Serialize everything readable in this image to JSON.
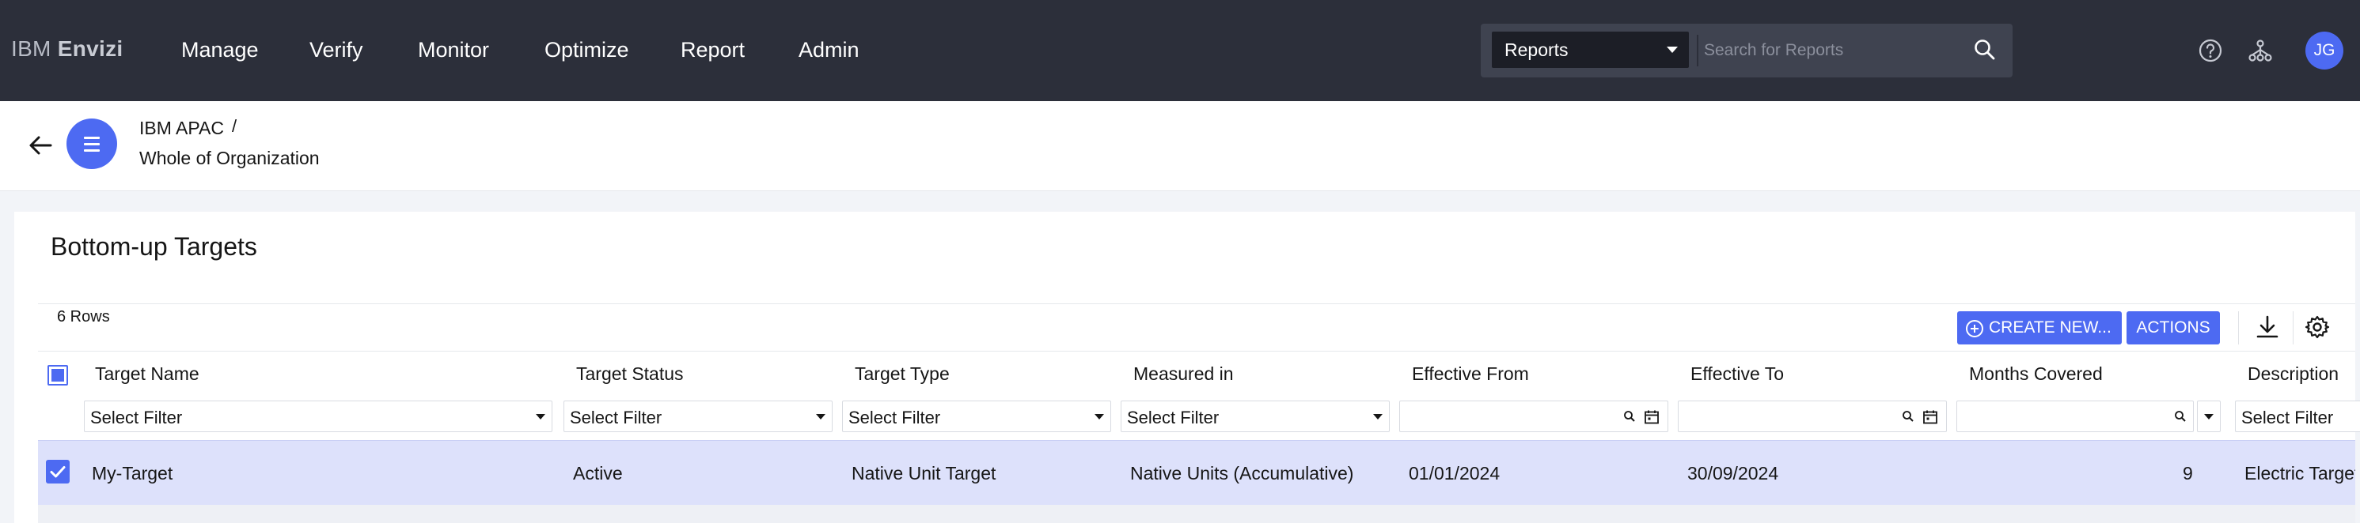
{
  "header": {
    "brand_prefix": "IBM",
    "brand_name": "Envizi",
    "nav": [
      "Manage",
      "Verify",
      "Monitor",
      "Optimize",
      "Report",
      "Admin"
    ],
    "search": {
      "scope": "Reports",
      "placeholder": "Search for Reports"
    },
    "icons": [
      "help-icon",
      "hierarchy-icon"
    ],
    "avatar_initials": "JG"
  },
  "breadcrumb": {
    "parent": "IBM APAC",
    "separator": "/",
    "current": "Whole of Organization"
  },
  "main": {
    "title": "Bottom-up Targets",
    "row_count": "6 Rows",
    "create_button": "CREATE NEW...",
    "actions_button": "ACTIONS",
    "columns": [
      {
        "label": "Target Name",
        "filter": "Select Filter",
        "filter_type": "select"
      },
      {
        "label": "Target Status",
        "filter": "Select Filter",
        "filter_type": "select"
      },
      {
        "label": "Target Type",
        "filter": "Select Filter",
        "filter_type": "select"
      },
      {
        "label": "Measured in",
        "filter": "Select Filter",
        "filter_type": "select"
      },
      {
        "label": "Effective From",
        "filter": "",
        "filter_type": "date"
      },
      {
        "label": "Effective To",
        "filter": "",
        "filter_type": "date"
      },
      {
        "label": "Months Covered",
        "filter": "",
        "filter_type": "number"
      },
      {
        "label": "Description",
        "filter": "Select Filter",
        "filter_type": "select"
      }
    ],
    "rows": [
      {
        "selected": true,
        "cells": [
          "My-Target",
          "Active",
          "Native Unit Target",
          "Native Units (Accumulative)",
          "01/01/2024",
          "30/09/2024",
          "9",
          "Electric Target"
        ]
      }
    ]
  },
  "colors": {
    "nav_bg": "#2c2f3a",
    "accent": "#4d6af2",
    "selected_row": "#dde1fb"
  }
}
